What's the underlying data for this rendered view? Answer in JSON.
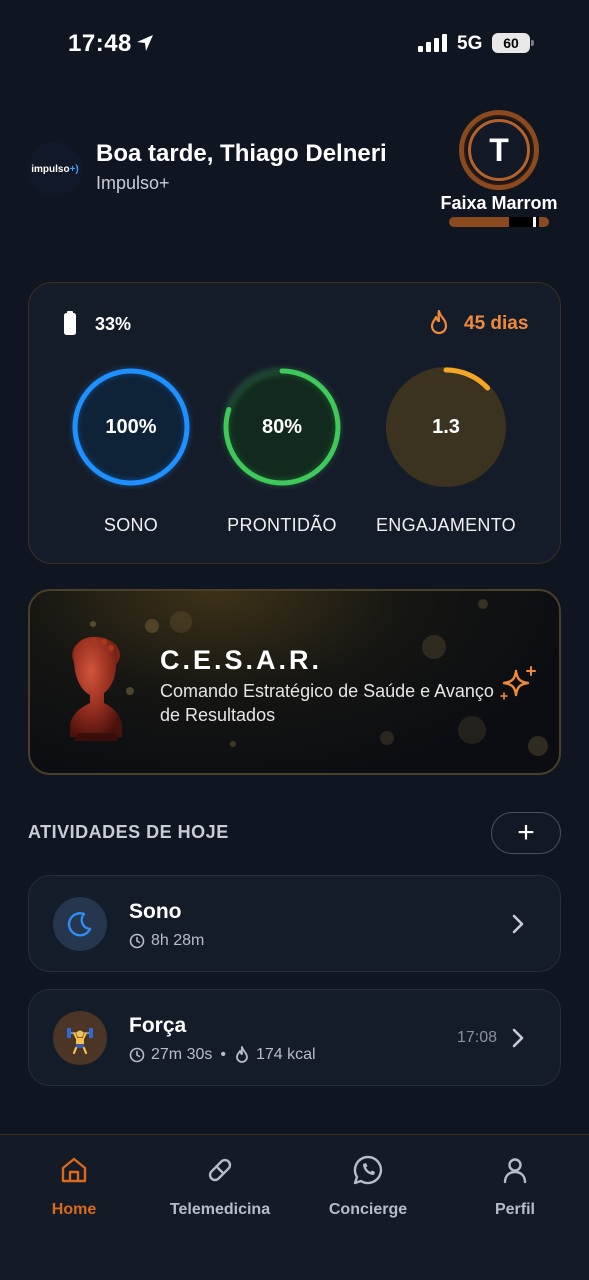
{
  "status_bar": {
    "time": "17:48",
    "network": "5G",
    "battery": "60"
  },
  "header": {
    "logo_text": "impulso",
    "greeting": "Boa tarde, Thiago Delneri",
    "company": "Impulso+",
    "avatar_initial": "T",
    "belt_label": "Faixa Marrom",
    "belt_color": "#8a4a1e"
  },
  "metrics": {
    "battery_pct": "33%",
    "streak": "45 dias",
    "rings": [
      {
        "value": "100%",
        "label": "SONO",
        "progress": 1.0,
        "color": "#1e90ff"
      },
      {
        "value": "80%",
        "label": "PRONTIDÃO",
        "progress": 0.8,
        "color": "#3ec95a"
      },
      {
        "value": "1.3",
        "label": "ENGAJAMENTO",
        "progress": 0.13,
        "color": "#f5a623"
      }
    ]
  },
  "cesar": {
    "title": "C.E.S.A.R.",
    "subtitle": "Comando Estratégico de Saúde e Avanço de Resultados"
  },
  "activities": {
    "title": "ATIVIDADES DE HOJE",
    "add_label": "+",
    "items": [
      {
        "name": "Sono",
        "duration": "8h 28m",
        "icon": "moon-icon"
      },
      {
        "name": "Força",
        "duration": "27m 30s",
        "separator": "•",
        "calories": "174 kcal",
        "time": "17:08",
        "icon": "weightlifter-icon"
      }
    ]
  },
  "tabbar": {
    "tabs": [
      {
        "label": "Home",
        "icon": "home-icon",
        "active": true
      },
      {
        "label": "Telemedicina",
        "icon": "pill-icon",
        "active": false
      },
      {
        "label": "Concierge",
        "icon": "whatsapp-icon",
        "active": false
      },
      {
        "label": "Perfil",
        "icon": "person-icon",
        "active": false
      }
    ],
    "active_color": "#d96a1c"
  }
}
